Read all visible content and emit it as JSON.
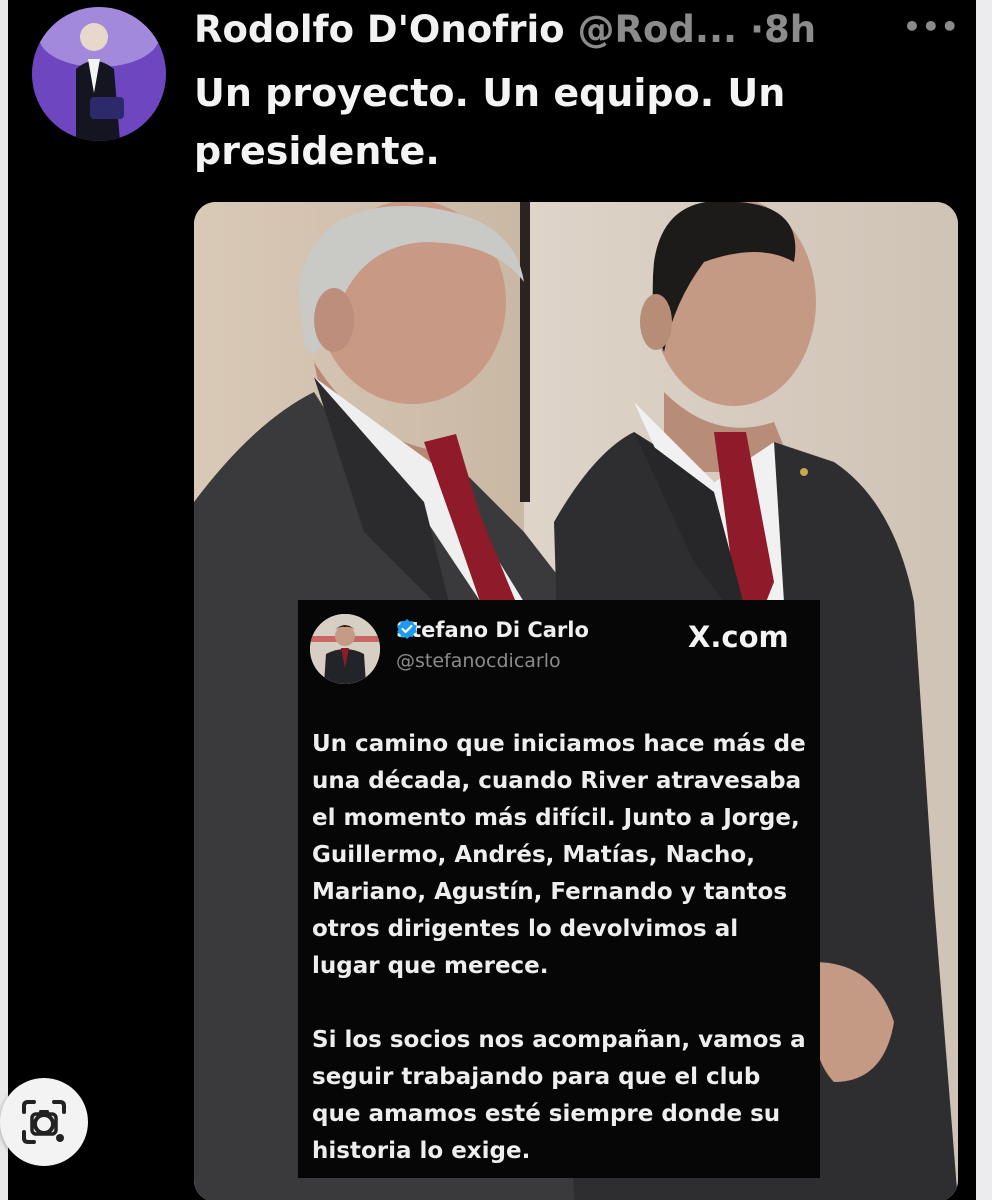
{
  "tweet": {
    "author_name": "Rodolfo D'Onofrio",
    "author_handle": "@Rod...",
    "separator": "·",
    "time": "8h",
    "more_icon": "more-horizontal-icon",
    "text": "Un proyecto. Un equipo. Un presidente."
  },
  "embedded_tweet": {
    "author_name": "Stefano Di Carlo",
    "author_handle": "@stefanocdicarlo",
    "source": "X.com",
    "verified_icon": "verified-badge-icon",
    "paragraphs": [
      "Un camino que iniciamos hace más de una década, cuando River atravesaba el momento más difícil. Junto a Jorge, Guillermo, Andrés, Matías, Nacho, Mariano, Agustín, Fernando y tantos otros dirigentes lo devolvimos al lugar que merece.",
      "Si los socios nos acompañan, vamos a seguir trabajando para que el club que amamos esté siempre donde su historia lo exige."
    ]
  },
  "overlay": {
    "lens_icon": "lens-camera-icon"
  },
  "colors": {
    "background": "#000000",
    "text_primary": "#f2f2f2",
    "text_secondary": "#8b8b8b",
    "verified": "#1d9bf0",
    "tie": "#8e1a2a"
  }
}
